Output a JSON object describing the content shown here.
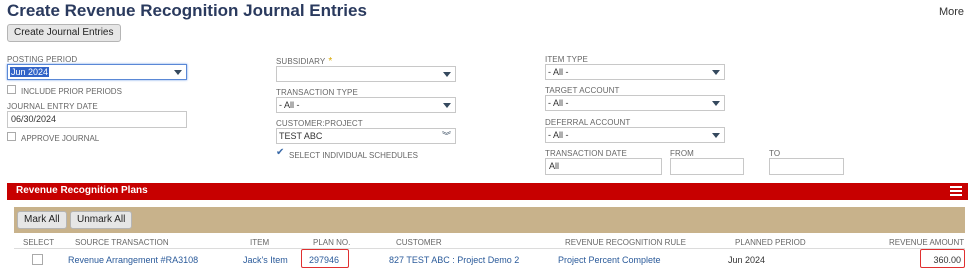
{
  "page": {
    "title": "Create Revenue Recognition Journal Entries",
    "more": "More"
  },
  "toolbar": {
    "create_button": "Create Journal Entries"
  },
  "form": {
    "posting_period": {
      "label": "POSTING PERIOD",
      "value": "Jun 2024"
    },
    "include_prior": {
      "label": "INCLUDE PRIOR PERIODS"
    },
    "journal_entry_date": {
      "label": "JOURNAL ENTRY DATE",
      "value": "06/30/2024"
    },
    "approve_journal": {
      "label": "APPROVE JOURNAL"
    },
    "subsidiary": {
      "label": "SUBSIDIARY",
      "required": "*",
      "value": ""
    },
    "transaction_type": {
      "label": "TRANSACTION TYPE",
      "value": "- All -"
    },
    "customer_project": {
      "label": "CUSTOMER:PROJECT",
      "value": "TEST ABC"
    },
    "select_individual": {
      "label": "SELECT INDIVIDUAL SCHEDULES",
      "checked": true
    },
    "item_type": {
      "label": "ITEM TYPE",
      "value": "- All -"
    },
    "target_account": {
      "label": "TARGET ACCOUNT",
      "value": "- All -"
    },
    "deferral_account": {
      "label": "DEFERRAL ACCOUNT",
      "value": "- All -"
    },
    "transaction_date": {
      "label": "TRANSACTION DATE",
      "value": "All"
    },
    "from": {
      "label": "FROM",
      "value": ""
    },
    "to": {
      "label": "TO",
      "value": ""
    }
  },
  "section": {
    "title": "Revenue Recognition Plans",
    "accent": "#c70000"
  },
  "sublist": {
    "mark_all": "Mark All",
    "unmark_all": "Unmark All",
    "columns": [
      "SELECT",
      "SOURCE TRANSACTION",
      "ITEM",
      "PLAN NO.",
      "CUSTOMER",
      "REVENUE RECOGNITION RULE",
      "PLANNED PERIOD",
      "REVENUE AMOUNT"
    ],
    "rows": [
      {
        "source_transaction": "Revenue Arrangement #RA3108",
        "item": "Jack's Item",
        "plan_no": "297946",
        "customer": "827 TEST ABC : Project Demo 2",
        "rule": "Project Percent Complete",
        "planned_period": "Jun 2024",
        "amount": "360.00"
      }
    ]
  }
}
